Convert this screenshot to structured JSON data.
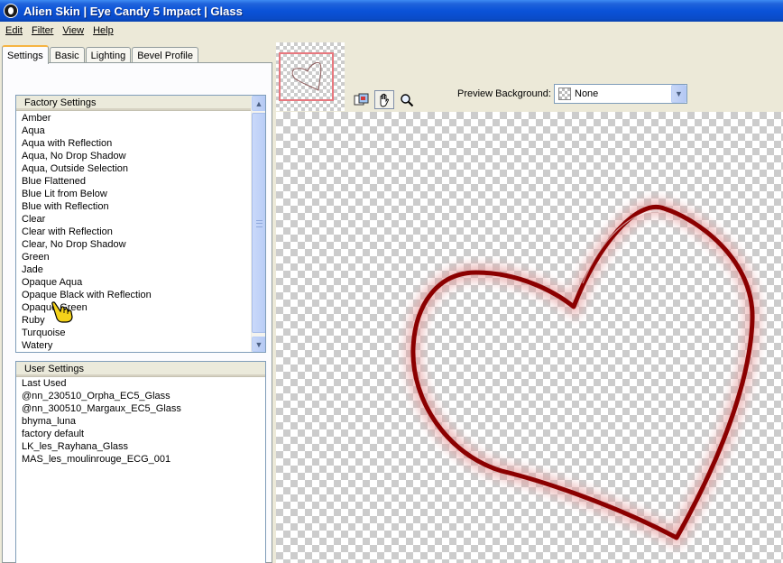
{
  "window": {
    "title": "Alien Skin | Eye Candy 5 Impact | Glass"
  },
  "menu": [
    {
      "label": "Edit"
    },
    {
      "label": "Filter"
    },
    {
      "label": "View"
    },
    {
      "label": "Help"
    }
  ],
  "tabs": [
    {
      "label": "Settings",
      "active": true
    },
    {
      "label": "Basic"
    },
    {
      "label": "Lighting"
    },
    {
      "label": "Bevel Profile"
    }
  ],
  "factory_settings": {
    "header": "Factory Settings",
    "items": [
      "Amber",
      "Aqua",
      "Aqua with Reflection",
      "Aqua, No Drop Shadow",
      "Aqua, Outside Selection",
      "Blue Flattened",
      "Blue Lit from Below",
      "Blue with Reflection",
      "Clear",
      "Clear with Reflection",
      "Clear, No Drop Shadow",
      "Green",
      "Jade",
      "Opaque Aqua",
      "Opaque Black with Reflection",
      "Opaque Green",
      "Ruby",
      "Turquoise",
      "Watery"
    ]
  },
  "user_settings": {
    "header": "User Settings",
    "items": [
      "Last Used",
      "@nn_230510_Orpha_EC5_Glass",
      "@nn_300510_Margaux_EC5_Glass",
      "bhyma_luna",
      "factory default",
      "LK_les_Rayhana_Glass",
      "MAS_les_moulinrouge_ECG_001"
    ]
  },
  "preview": {
    "background_label": "Preview Background:",
    "background_value": "None",
    "tools": [
      "preview-toggle-icon",
      "hand-pan-icon",
      "zoom-icon"
    ],
    "heart_color": "#8b0000"
  },
  "colors": {
    "titlebar": "#0a52d8",
    "accent_tab": "#f6b443",
    "window_bg": "#ece9d8"
  }
}
